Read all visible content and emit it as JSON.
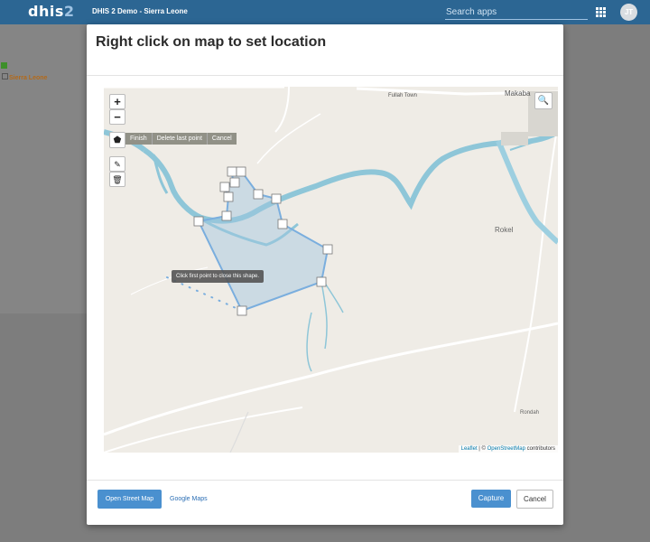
{
  "header": {
    "logo_main": "dhis",
    "logo_num": "2",
    "app_title": "DHIS 2 Demo - Sierra Leone",
    "search_placeholder": "Search apps",
    "avatar_initials": "JT",
    "colors": {
      "bar": "#2c6693"
    }
  },
  "sidebar": {
    "tree_item": "Sierra Leone"
  },
  "modal": {
    "title": "Right click on map to set location",
    "map": {
      "draw_actions": [
        "Finish",
        "Delete last point",
        "Cancel"
      ],
      "tooltip": "Click first point to close this shape.",
      "places": {
        "fullah": "Fullah Town",
        "makaba": "Makaba",
        "rokel": "Rokel",
        "rondah": "Rondah"
      },
      "attribution": {
        "leaflet": "Leaflet",
        "sep": " | © ",
        "osm": "OpenStreetMap",
        "rest": " contributors"
      },
      "icons": {
        "zoom_in": "+",
        "zoom_out": "−",
        "polygon": "⬟",
        "edit": "✎",
        "trash": "🗑",
        "search": "🔍"
      }
    },
    "footer": {
      "osm_button": "Open Street Map",
      "google_button": "Google Maps",
      "capture_button": "Capture",
      "cancel_button": "Cancel"
    }
  }
}
